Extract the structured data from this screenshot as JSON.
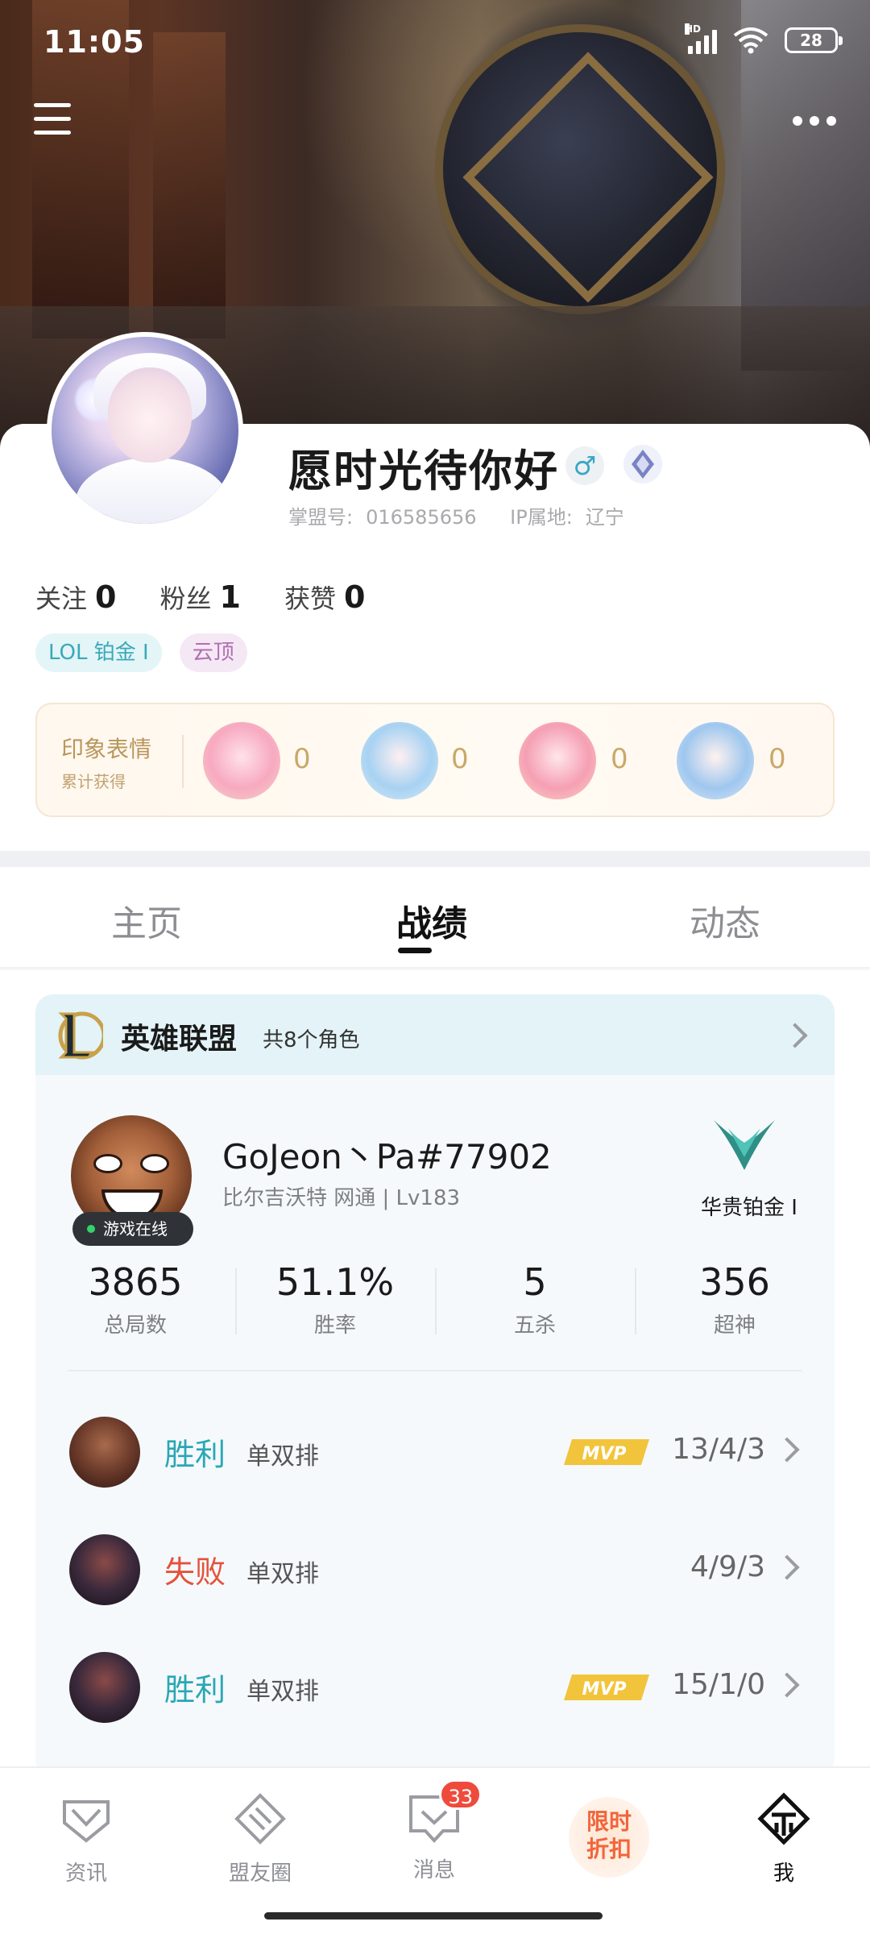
{
  "status_bar": {
    "time": "11:05",
    "network": "HD",
    "battery": "28"
  },
  "profile": {
    "name": "愿时光待你好",
    "gender_symbol": "♂",
    "id_label": "掌盟号:",
    "id_value": "016585656",
    "ip_label": "IP属地:",
    "ip_value": "辽宁",
    "stats": [
      {
        "label": "关注",
        "value": "0"
      },
      {
        "label": "粉丝",
        "value": "1"
      },
      {
        "label": "获赞",
        "value": "0"
      }
    ],
    "tags": [
      "LOL 铂金 I",
      "云顶"
    ]
  },
  "impressions": {
    "title": "印象表情",
    "subtitle": "累计获得",
    "items": [
      {
        "icon": "wink-emoji-icon",
        "count": "0"
      },
      {
        "icon": "wave-emoji-icon",
        "count": "0"
      },
      {
        "icon": "love-emoji-icon",
        "count": "0"
      },
      {
        "icon": "gg-emoji-icon",
        "count": "0"
      }
    ]
  },
  "tabs": [
    {
      "label": "主页",
      "active": false
    },
    {
      "label": "战绩",
      "active": true
    },
    {
      "label": "动态",
      "active": false
    }
  ],
  "game": {
    "name": "英雄联盟",
    "role_count": "共8个角色",
    "account": {
      "name": "GoJeon丶Pa#77902",
      "meta": "比尔吉沃特  网通 | Lv183",
      "online": "游戏在线",
      "rank": "华贵铂金 I"
    },
    "summary": [
      {
        "value": "3865",
        "label": "总局数"
      },
      {
        "value": "51.1%",
        "label": "胜率"
      },
      {
        "value": "5",
        "label": "五杀"
      },
      {
        "value": "356",
        "label": "超神"
      }
    ],
    "matches": [
      {
        "result": "胜利",
        "outcome": "win",
        "mode": "单双排",
        "mvp": true,
        "kda": "13/4/3"
      },
      {
        "result": "失败",
        "outcome": "lose",
        "mode": "单双排",
        "mvp": false,
        "kda": "4/9/3"
      },
      {
        "result": "胜利",
        "outcome": "win",
        "mode": "单双排",
        "mvp": true,
        "kda": "15/1/0"
      }
    ]
  },
  "bottom_nav": [
    {
      "label": "资讯",
      "icon": "news-icon"
    },
    {
      "label": "盟友圈",
      "icon": "friends-circle-icon"
    },
    {
      "label": "消息",
      "icon": "message-icon",
      "badge": "33"
    },
    {
      "label": "",
      "icon": "promo-icon"
    },
    {
      "label": "我",
      "icon": "me-icon",
      "active": true
    }
  ],
  "promo": {
    "line1": "限时",
    "line2": "折扣"
  },
  "colors": {
    "win": "#2aa7b5",
    "lose": "#e4523b",
    "accent_gold": "#c9a869",
    "badge_red": "#ef4b3c"
  }
}
